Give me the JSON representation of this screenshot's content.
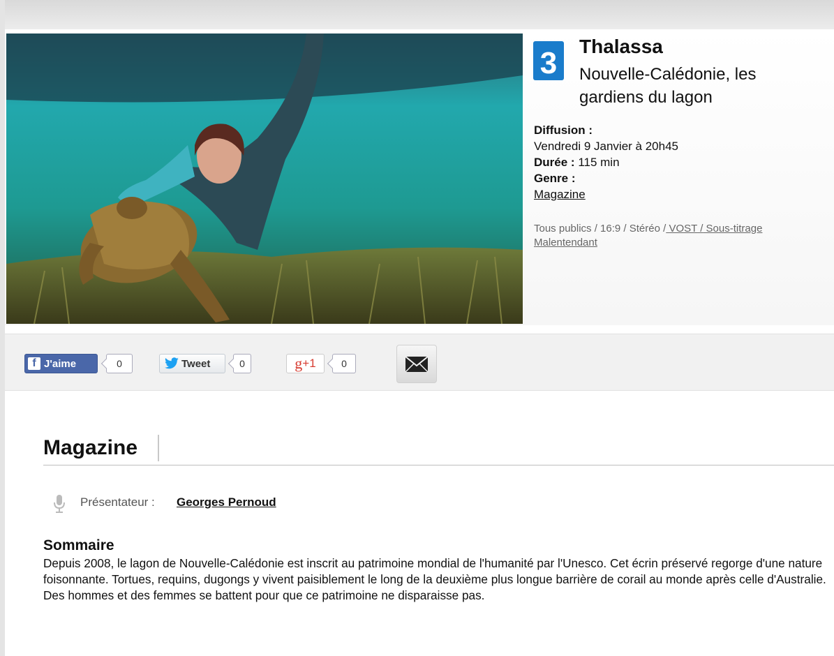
{
  "channel": {
    "logo_icon": "france3-logo-icon",
    "logo_color": "#1a7ccb"
  },
  "program": {
    "title": "Thalassa",
    "subtitle": "Nouvelle-Calédonie, les gardiens du lagon"
  },
  "details": {
    "diffusion_label": "Diffusion :",
    "diffusion_value": "Vendredi 9 Janvier à 20h45",
    "duree_label": "Durée :",
    "duree_value": "115 min",
    "genre_label": "Genre :",
    "genre_value": "Magazine"
  },
  "tech": {
    "plain": "Tous publics / 16:9 / Stéréo /",
    "vost": " VOST",
    "sep": " /",
    "sous_titrage": " Sous-titrage Malentendant"
  },
  "share": {
    "facebook_label": "J'aime",
    "facebook_count": "0",
    "twitter_label": "Tweet",
    "twitter_count": "0",
    "gplus_label": "+1",
    "gplus_count": "0",
    "mail_icon": "envelope-icon",
    "facebook_color": "#4a67a9",
    "twitter_color": "#1da1f2",
    "gplus_color": "#d73d32"
  },
  "section": {
    "title": "Magazine",
    "presenter_label": "Présentateur :",
    "presenter_name": "Georges Pernoud"
  },
  "summary": {
    "title": "Sommaire",
    "body": "Depuis 2008, le lagon de Nouvelle-Calédonie est inscrit au patrimoine mondial de l'humanité par l'Unesco. Cet écrin préservé regorge d'une nature foisonnante. Tortues, requins, dugongs y vivent paisiblement le long de la deuxième plus longue barrière de corail au monde après celle d'Australie. Des hommes et des femmes se battent pour que ce patrimoine ne disparaisse pas."
  }
}
